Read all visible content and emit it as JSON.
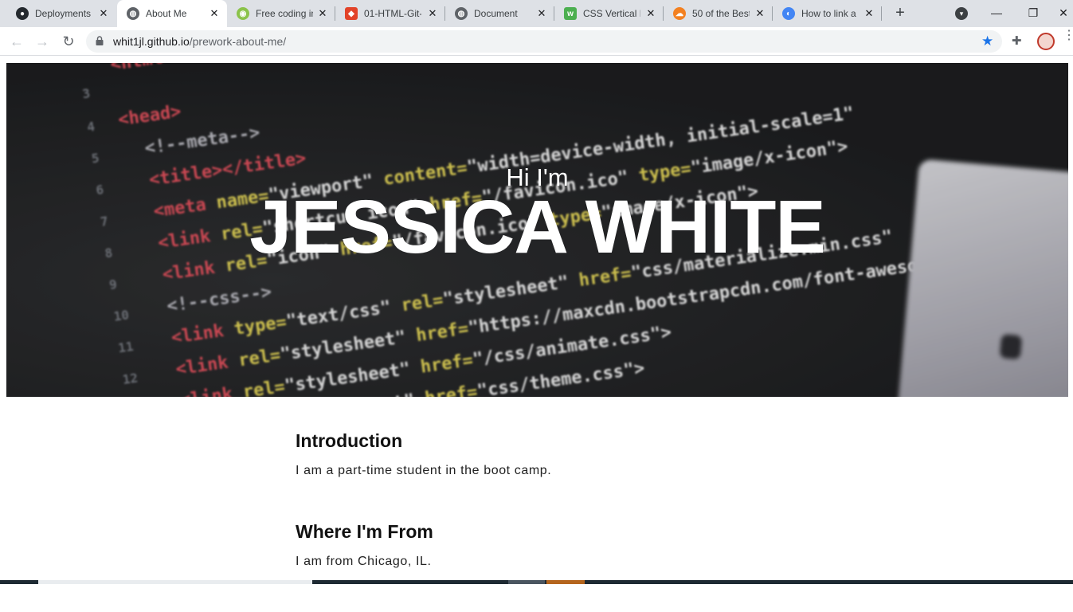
{
  "browser": {
    "tabs": [
      {
        "title": "Deployments",
        "icon": "github-icon"
      },
      {
        "title": "About Me",
        "icon": "globe-icon"
      },
      {
        "title": "Free coding in",
        "icon": "codepen-icon"
      },
      {
        "title": "01-HTML-Git-",
        "icon": "gitlab-icon"
      },
      {
        "title": "Document",
        "icon": "globe-icon"
      },
      {
        "title": "CSS Vertical N",
        "icon": "w3schools-icon"
      },
      {
        "title": "50 of the Best",
        "icon": "cloud-icon"
      },
      {
        "title": "How to link a",
        "icon": "google-icon"
      }
    ],
    "active_tab": 1,
    "new_tab_label": "+",
    "address": {
      "host": "whit1jl.github.io",
      "path": "/prework-about-me/"
    }
  },
  "hero": {
    "subtitle": "Hi I'm",
    "name": "JESSICA WHITE"
  },
  "sections": [
    {
      "heading": "Introduction",
      "text": "I am a part-time student in the boot camp."
    },
    {
      "heading": "Where I'm From",
      "text": "I am from Chicago, IL."
    }
  ]
}
